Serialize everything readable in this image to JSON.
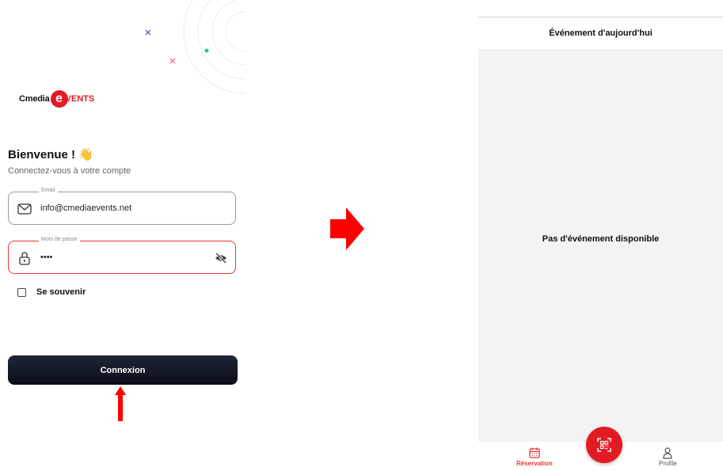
{
  "login": {
    "logo_prefix": "Cmedia",
    "logo_e": "e",
    "logo_suffix": "VENTS",
    "welcome": "Bienvenue !",
    "welcome_emoji": "👋",
    "subtitle": "Connectez-vous à votre compte",
    "email_label": "Email",
    "email_value": "info@cmediaevents.net",
    "password_label": "Mots de passe",
    "password_value": "••••",
    "remember_label": "Se souvenir",
    "remember_checked": false,
    "connect_button": "Connexion"
  },
  "events": {
    "header_title": "Événement d'aujourd'hui",
    "empty_message": "Pas d'événement disponible",
    "nav": {
      "reservation": "Réservation",
      "profile": "Profile"
    }
  },
  "icons": {
    "email": "mail-icon",
    "password": "lock-icon",
    "visibility": "eye-off-icon",
    "reservation": "calendar-icon",
    "profile": "person-icon",
    "fab": "qr-scan-icon",
    "arrow_right": "arrow-right-icon",
    "arrow_up": "arrow-up-icon"
  },
  "colors": {
    "brand_red": "#e21b23",
    "error_border": "#e53935",
    "button_dark": "#0f1420",
    "annotation_red": "#ff0000",
    "content_bg": "#f3f3f3"
  }
}
